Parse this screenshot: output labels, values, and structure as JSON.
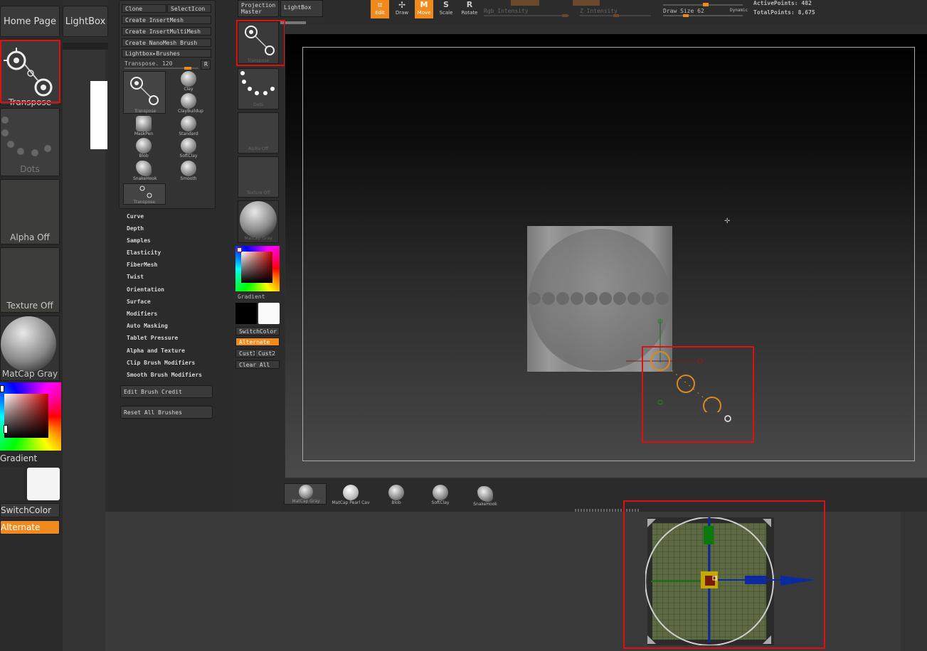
{
  "left_panel": {
    "home_label": "Home Page",
    "lightbox_label": "LightBox",
    "tiles": {
      "transpose": "Transpose",
      "dots": "Dots",
      "alpha": "Alpha Off",
      "texture": "Texture Off",
      "matcap": "MatCap Gray"
    },
    "gradient_label": "Gradient",
    "switchcolor_label": "SwitchColor",
    "alternate_label": "Alternate"
  },
  "brush_palette": {
    "clone": "Clone",
    "select_icon": "SelectIcon",
    "create_insertmesh": "Create InsertMesh",
    "create_insertmultimesh": "Create InsertMultiMesh",
    "create_nanomesh": "Create NanoMesh Brush",
    "lightbox_brushes": "Lightbox▸Brushes",
    "transpose_value": "Transpose. 120",
    "r_button": "R",
    "brushes": [
      "Transpose",
      "Clay",
      "ClayBuildup",
      "MaskPen",
      "Standard",
      "Blob",
      "SoftClay",
      "SnakeHook",
      "Smooth",
      "Transpose"
    ],
    "subpalettes": [
      "Curve",
      "Depth",
      "Samples",
      "Elasticity",
      "FiberMesh",
      "Twist",
      "Orientation",
      "Surface",
      "Modifiers",
      "Auto Masking",
      "Tablet Pressure",
      "Alpha and Texture",
      "Clip Brush Modifiers",
      "Smooth Brush Modifiers"
    ],
    "edit_credit": "Edit Brush Credit",
    "reset_all": "Reset All Brushes"
  },
  "tray": {
    "projection": "Projection Master",
    "lightbox": "LightBox",
    "tiles": {
      "transpose": "Transpose",
      "dots": "Dots",
      "alpha": "Alpha Off",
      "texture": "Texture Off",
      "matcap": "MatCap Gray"
    },
    "gradient": "Gradient",
    "switchcolor": "SwitchColor",
    "alternate": "Alternate",
    "cust1": "Cust1",
    "cust2": "Cust2",
    "clear_all": "Clear All"
  },
  "top_toolbar": {
    "edit": "Edit",
    "draw": "Draw",
    "move": "Move",
    "scale": "Scale",
    "rotate": "Rotate",
    "rgb_intensity": "Rgb Intensity",
    "z_intensity": "Z Intensity",
    "draw_size": "Draw Size 62",
    "dynamic": "Dynamic",
    "active_points": "ActivePoints: 482",
    "total_points": "TotalPoints: 8,675"
  },
  "bottom_shelf": [
    "MatCap Gray",
    "MatCap Pearl Cav",
    "Blob",
    "SoftClay",
    "SnakeHook"
  ],
  "colors": {
    "accent": "#f08a1c",
    "highlight": "#e01010"
  }
}
